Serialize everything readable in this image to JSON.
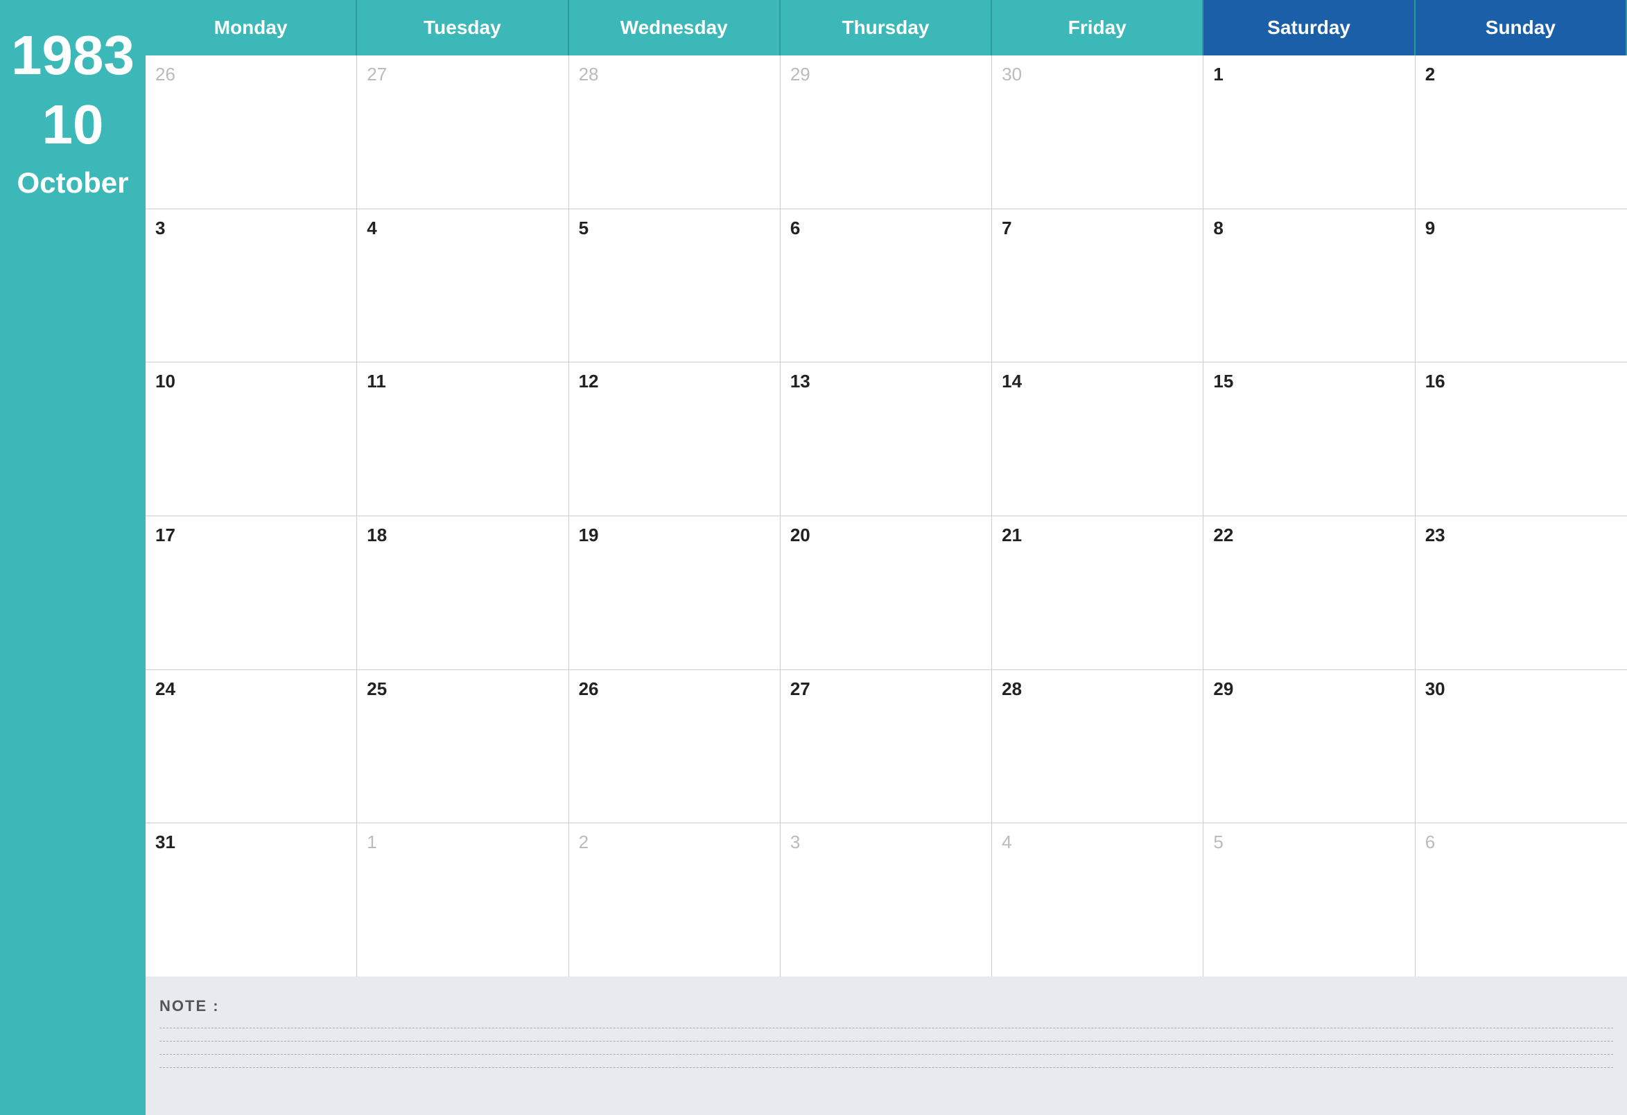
{
  "sidebar": {
    "year": "1983",
    "month_number": "10",
    "month_name": "October"
  },
  "headers": {
    "days": [
      {
        "label": "Monday",
        "type": "weekday"
      },
      {
        "label": "Tuesday",
        "type": "weekday"
      },
      {
        "label": "Wednesday",
        "type": "weekday"
      },
      {
        "label": "Thursday",
        "type": "weekday"
      },
      {
        "label": "Friday",
        "type": "weekday"
      },
      {
        "label": "Saturday",
        "type": "weekend"
      },
      {
        "label": "Sunday",
        "type": "weekend"
      }
    ]
  },
  "weeks": [
    {
      "days": [
        {
          "number": "26",
          "active": false
        },
        {
          "number": "27",
          "active": false
        },
        {
          "number": "28",
          "active": false
        },
        {
          "number": "29",
          "active": false
        },
        {
          "number": "30",
          "active": false
        },
        {
          "number": "1",
          "active": true
        },
        {
          "number": "2",
          "active": true
        }
      ]
    },
    {
      "days": [
        {
          "number": "3",
          "active": true
        },
        {
          "number": "4",
          "active": true
        },
        {
          "number": "5",
          "active": true
        },
        {
          "number": "6",
          "active": true
        },
        {
          "number": "7",
          "active": true
        },
        {
          "number": "8",
          "active": true
        },
        {
          "number": "9",
          "active": true
        }
      ]
    },
    {
      "days": [
        {
          "number": "10",
          "active": true
        },
        {
          "number": "11",
          "active": true
        },
        {
          "number": "12",
          "active": true
        },
        {
          "number": "13",
          "active": true
        },
        {
          "number": "14",
          "active": true
        },
        {
          "number": "15",
          "active": true
        },
        {
          "number": "16",
          "active": true
        }
      ]
    },
    {
      "days": [
        {
          "number": "17",
          "active": true
        },
        {
          "number": "18",
          "active": true
        },
        {
          "number": "19",
          "active": true
        },
        {
          "number": "20",
          "active": true
        },
        {
          "number": "21",
          "active": true
        },
        {
          "number": "22",
          "active": true
        },
        {
          "number": "23",
          "active": true
        }
      ]
    },
    {
      "days": [
        {
          "number": "24",
          "active": true
        },
        {
          "number": "25",
          "active": true
        },
        {
          "number": "26",
          "active": true
        },
        {
          "number": "27",
          "active": true
        },
        {
          "number": "28",
          "active": true
        },
        {
          "number": "29",
          "active": true
        },
        {
          "number": "30",
          "active": true
        }
      ]
    },
    {
      "days": [
        {
          "number": "31",
          "active": true
        },
        {
          "number": "1",
          "active": false
        },
        {
          "number": "2",
          "active": false
        },
        {
          "number": "3",
          "active": false
        },
        {
          "number": "4",
          "active": false
        },
        {
          "number": "5",
          "active": false
        },
        {
          "number": "6",
          "active": false
        }
      ]
    }
  ],
  "notes": {
    "label": "NOTE :",
    "lines": 4
  }
}
